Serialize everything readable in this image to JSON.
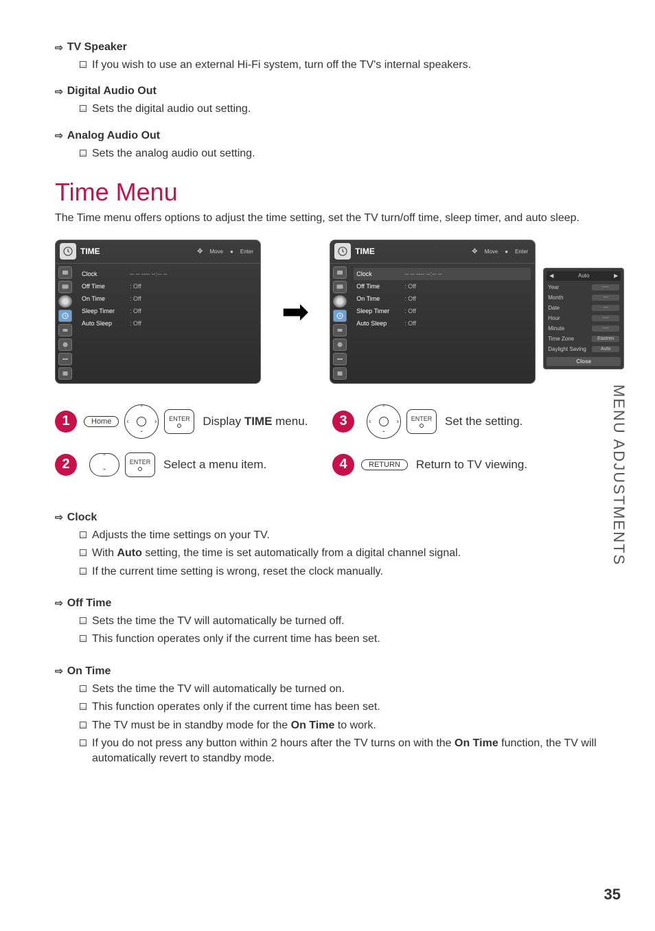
{
  "top_sections": [
    {
      "title": "TV Speaker",
      "bullets": [
        "If you wish to use an external Hi-Fi system, turn off the TV's internal speakers."
      ]
    },
    {
      "title": "Digital Audio Out",
      "bullets": [
        "Sets the digital audio out setting."
      ]
    },
    {
      "title": "Analog Audio Out",
      "bullets": [
        "Sets the analog audio out setting."
      ]
    }
  ],
  "main_heading": "Time Menu",
  "intro": "The Time menu offers options to adjust the time setting, set the TV turn/off time, sleep timer, and auto sleep.",
  "osd": {
    "title": "TIME",
    "hint_move": "Move",
    "hint_enter": "Enter",
    "rows": [
      {
        "label": "Clock",
        "value": "-- -- ---- --:-- --"
      },
      {
        "label": "Off Time",
        "value": ": Off"
      },
      {
        "label": "On Time",
        "value": ": Off"
      },
      {
        "label": "Sleep Timer",
        "value": ": Off"
      },
      {
        "label": "Auto Sleep",
        "value": ": Off"
      }
    ]
  },
  "popup": {
    "top": "Auto",
    "rows": [
      {
        "label": "Year",
        "value": "----"
      },
      {
        "label": "Month",
        "value": "---"
      },
      {
        "label": "Date",
        "value": "---"
      },
      {
        "label": "Hour",
        "value": "----"
      },
      {
        "label": "Minute",
        "value": "----"
      },
      {
        "label": "Time Zone",
        "value": "Eastren"
      },
      {
        "label": "Daylight Saving",
        "value": "Auto"
      }
    ],
    "close": "Close"
  },
  "steps": {
    "s1_text_a": "Display ",
    "s1_bold": "TIME",
    "s1_text_b": " menu.",
    "s2": "Select a menu item.",
    "s3": "Set the setting.",
    "s4": "Return to TV viewing.",
    "home": "Home",
    "enter": "ENTER",
    "return": "RETURN"
  },
  "bottom_sections": [
    {
      "title": "Clock",
      "bullets": [
        {
          "parts": [
            "Adjusts the time settings on your TV."
          ]
        },
        {
          "parts": [
            "With ",
            {
              "b": "Auto"
            },
            " setting, the time is set automatically from a digital channel signal."
          ]
        },
        {
          "parts": [
            "If the current time setting is wrong, reset the clock manually."
          ]
        }
      ]
    },
    {
      "title": "Off Time",
      "bullets": [
        {
          "parts": [
            "Sets the time the TV will automatically be turned off."
          ]
        },
        {
          "parts": [
            "This function operates only if the current time has been set."
          ]
        }
      ]
    },
    {
      "title": "On Time",
      "bullets": [
        {
          "parts": [
            "Sets the time the TV will automatically be turned on."
          ]
        },
        {
          "parts": [
            "This function operates only if the current time has been set."
          ]
        },
        {
          "parts": [
            "The TV must be in standby mode for the ",
            {
              "b": "On Time"
            },
            " to work."
          ]
        },
        {
          "parts": [
            "If you do not press any button within 2 hours after the TV turns on with the ",
            {
              "b": "On Time"
            },
            " function, the TV will automatically revert to standby mode."
          ]
        }
      ]
    }
  ],
  "side_tab": "MENU ADJUSTMENTS",
  "page": "35"
}
